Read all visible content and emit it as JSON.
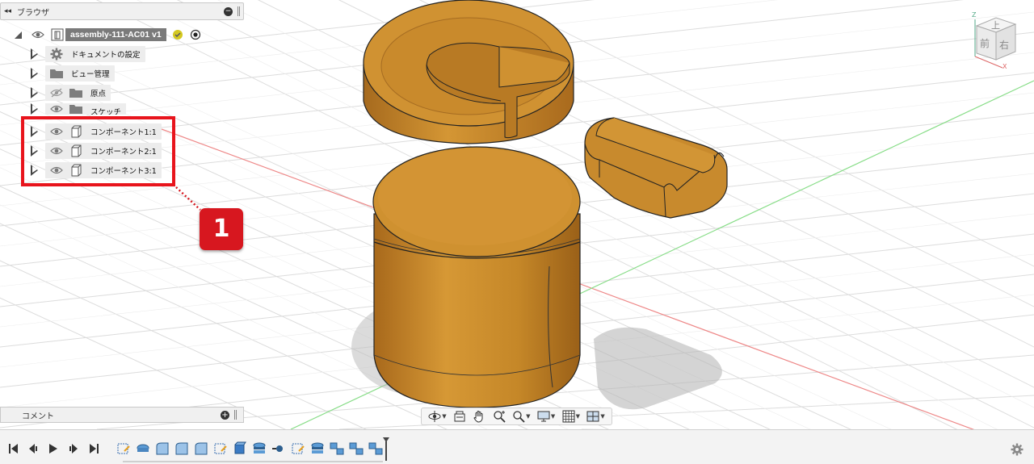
{
  "browser": {
    "title": "ブラウザ",
    "root": {
      "label": "assembly-111-AC01 v1"
    },
    "items": [
      {
        "label": "ドキュメントの設定",
        "icon": "gear-icon"
      },
      {
        "label": "ビュー管理",
        "icon": "folder-icon"
      },
      {
        "label": "原点",
        "icon": "folder-icon"
      },
      {
        "label": "スケッチ",
        "icon": "folder-icon"
      },
      {
        "label": "コンポーネント1:1",
        "icon": "component-icon"
      },
      {
        "label": "コンポーネント2:1",
        "icon": "component-icon"
      },
      {
        "label": "コンポーネント3:1",
        "icon": "component-icon"
      }
    ]
  },
  "callout": {
    "number": "1",
    "color": "#d7171f"
  },
  "comments": {
    "title": "コメント"
  },
  "viewcube": {
    "top": "上",
    "front": "前",
    "right": "右",
    "axis_z": "Z",
    "axis_x": "X"
  },
  "colors": {
    "body": "#c98a2e",
    "highlight": "#e8141c",
    "grid": "#d9d9d9"
  }
}
